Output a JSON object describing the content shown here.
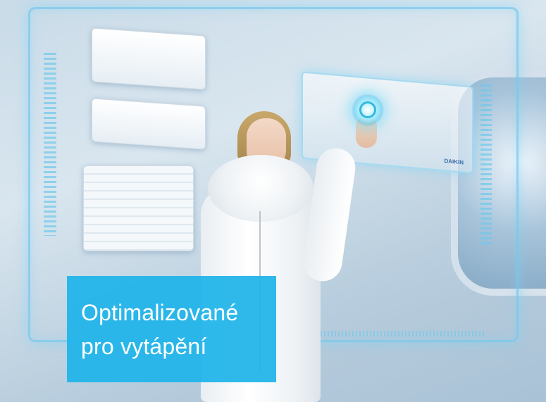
{
  "caption": {
    "line1": "Optimalizované",
    "line2": "pro vytápění"
  },
  "unit_logo": "DAIKIN",
  "colors": {
    "caption_background": "#1FB4E9",
    "caption_text": "#FFFFFF",
    "hud_glow": "#78C8EB"
  }
}
